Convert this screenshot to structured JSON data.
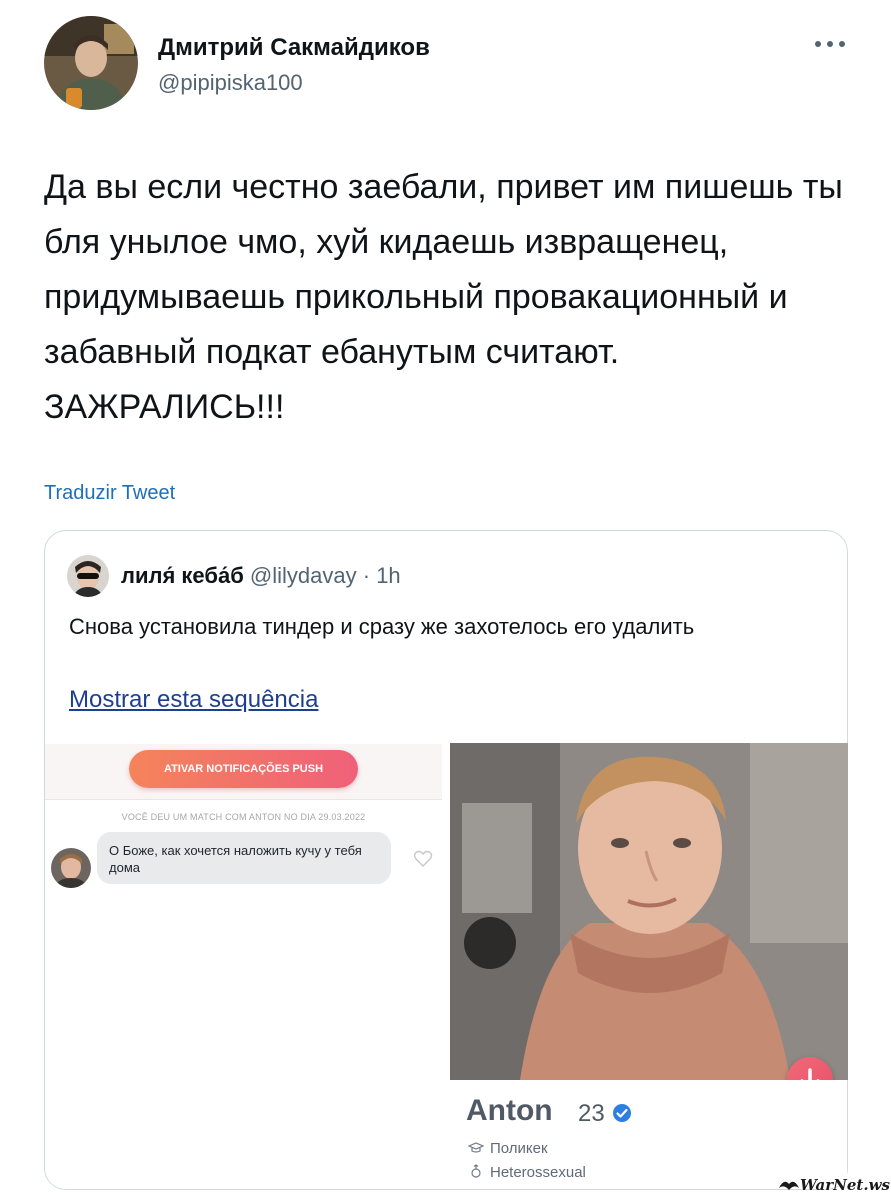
{
  "tweet": {
    "author_name": "Дмитрий Сакмайдиков",
    "author_handle": "@pipipiska100",
    "text": "Да вы если честно заебали, привет им пишешь ты бля унылое чмо, хуй кидаешь извращенец, придумываешь прикольный провакационный и забавный подкат ебанутым считают. ЗАЖРАЛИСЬ!!!",
    "translate_label": "Traduzir Tweet",
    "more_icon": "more-horizontal-icon"
  },
  "quoted": {
    "author_name": "лиля́ кеба́б",
    "author_handle": "@lilydavay",
    "time": "· 1h",
    "text": "Снова установила тиндер и сразу же захотелось его удалить",
    "thread_link": "Mostrar esta sequência"
  },
  "screenshot": {
    "push_button": "ATIVAR NOTIFICAÇÕES PUSH",
    "match_text": "VOCÊ DEU UM MATCH COM ANTON NO DIA 29.03.2022",
    "message": "О Боже, как хочется наложить кучу у тебя дома",
    "profile": {
      "name": "Anton",
      "age": "23",
      "job": "Поликек",
      "orientation": "Heterossexual"
    },
    "accent_color": "#ea4f68"
  },
  "watermark": "WarNet.ws"
}
